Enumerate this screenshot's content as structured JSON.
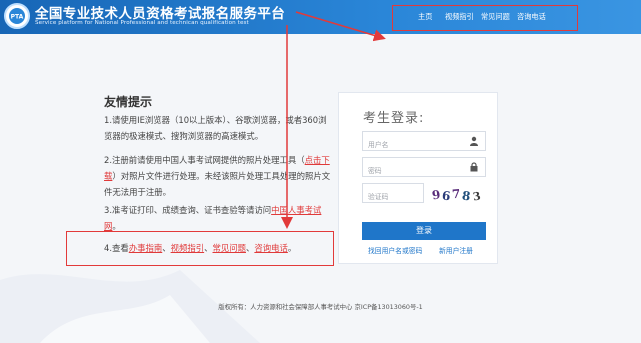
{
  "header": {
    "title": "全国专业技术人员资格考试报名服务平台",
    "subtitle": "Service platform for National Professional and technican qualification test",
    "logo_text": "PTA"
  },
  "nav": {
    "items": [
      {
        "label": "主页"
      },
      {
        "label": "视频指引"
      },
      {
        "label": "常见问题"
      },
      {
        "label": "咨询电话"
      }
    ]
  },
  "tips": {
    "title": "友情提示",
    "tip1": "1.请使用IE浏览器（10以上版本）、谷歌浏览器，或者360浏览器的极速模式、搜狗浏览器的高速模式。",
    "tip2_before": "2.注册前请使用中国人事考试网提供的照片处理工具（",
    "tip2_link": "点击下载",
    "tip2_after": "）对照片文件进行处理。未经该照片处理工具处理的照片文件无法用于注册。",
    "tip3_before": "3.准考证打印、成绩查询、证书查验等请访问",
    "tip3_link": "中国人事考试网",
    "tip3_after": "。",
    "tip4_before": "4.查看",
    "tip4_links": [
      "办事指南",
      "视频指引",
      "常见问题",
      "咨询电话"
    ],
    "tip4_sep": "、",
    "tip4_after": "。"
  },
  "login": {
    "title": "考生登录:",
    "username_placeholder": "用户名",
    "password_placeholder": "密码",
    "captcha_placeholder": "验证码",
    "captcha_chars": [
      "9",
      "6",
      "7",
      "8",
      "3"
    ],
    "login_button": "登录",
    "forgot_link": "找回用户名或密码",
    "register_link": "新用户注册"
  },
  "footer": {
    "text": "版权所有：人力资源和社会保障部人事考试中心 京ICP备13013060号-1"
  },
  "colors": {
    "header_blue": "#1f76c9",
    "highlight_red": "#e23a3a",
    "link_red": "#e03a3a",
    "button_blue": "#1f76c9"
  }
}
